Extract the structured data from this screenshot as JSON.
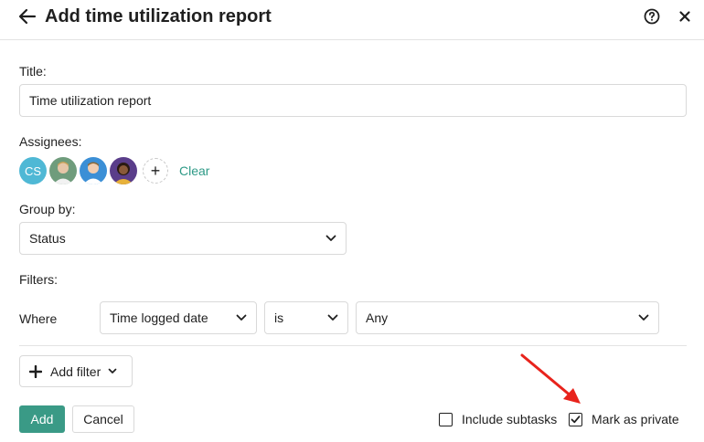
{
  "header": {
    "title": "Add time utilization report",
    "back_icon": "arrow-left-icon",
    "help_icon": "question-circle-icon",
    "close_icon": "close-icon"
  },
  "form": {
    "title_label": "Title:",
    "title_value": "Time utilization report",
    "assignees_label": "Assignees:",
    "assignees": [
      {
        "initials": "CS",
        "color": "#4fb8d5"
      },
      {
        "initials": "",
        "color": "#5f8f6e"
      },
      {
        "initials": "",
        "color": "#3b8fd6"
      },
      {
        "initials": "",
        "color": "#5a3d8a"
      }
    ],
    "add_assignee_label": "+",
    "clear_label": "Clear",
    "group_by_label": "Group by:",
    "group_by_value": "Status",
    "filters_label": "Filters:",
    "where_label": "Where",
    "filter_field": "Time logged date",
    "filter_operator": "is",
    "filter_value": "Any",
    "add_filter_label": "Add filter"
  },
  "footer": {
    "add_label": "Add",
    "cancel_label": "Cancel",
    "include_subtasks_label": "Include subtasks",
    "include_subtasks_checked": false,
    "mark_private_label": "Mark as private",
    "mark_private_checked": true
  },
  "colors": {
    "accent": "#3a9a86",
    "link": "#2e9a87",
    "annotation_arrow": "#e8231c"
  }
}
